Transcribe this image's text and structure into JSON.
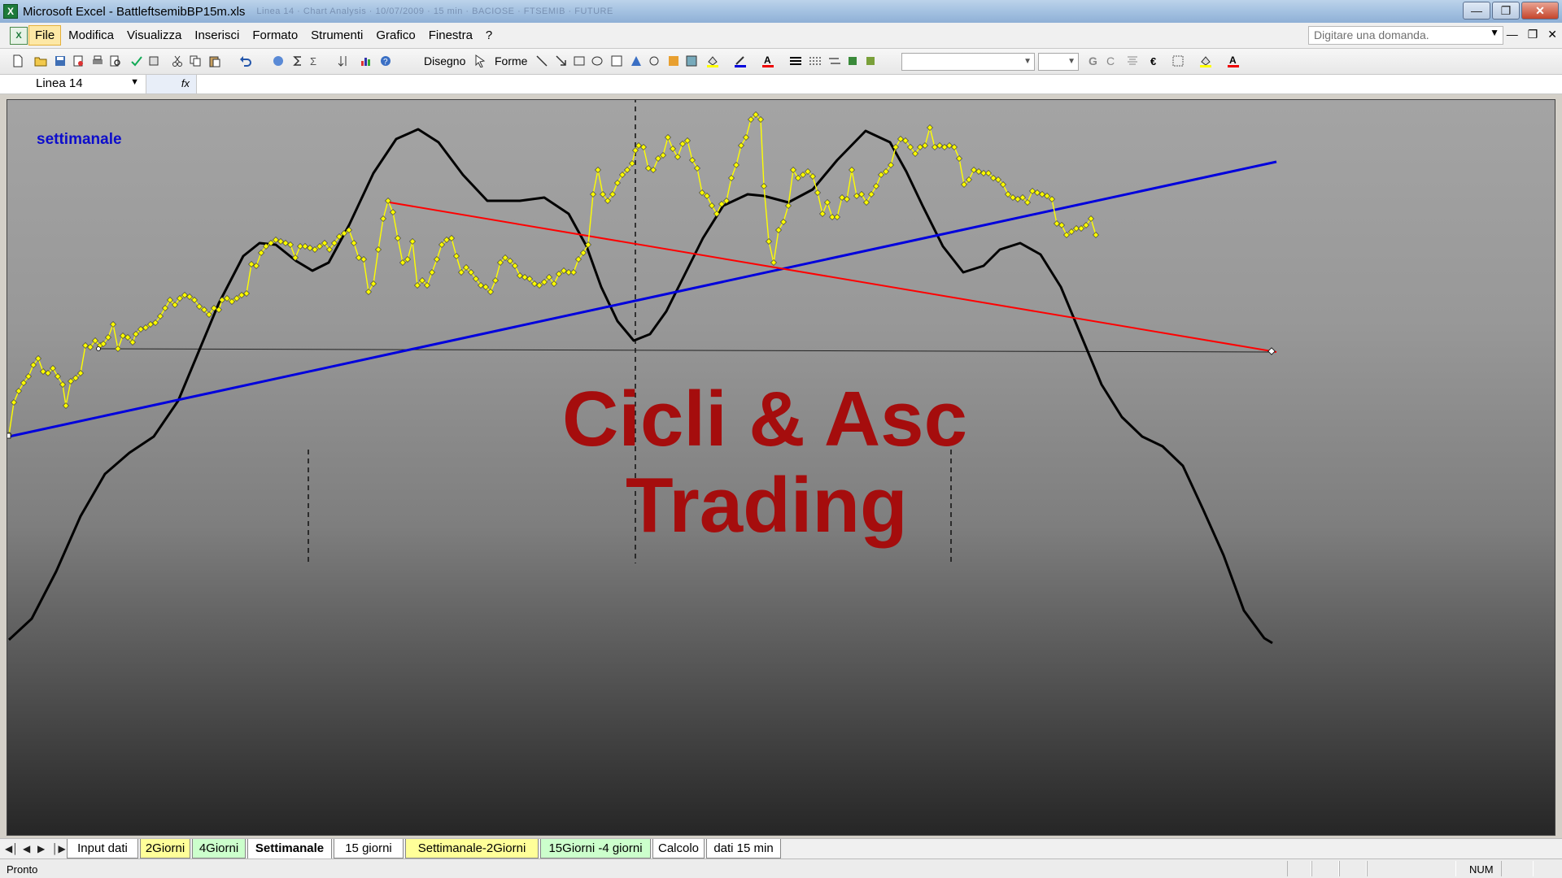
{
  "window": {
    "title": "Microsoft Excel - BattleftsemibBP15m.xls",
    "title_ghost": "Linea 14 · Chart Analysis · 10/07/2009 · 15 min · BACIOSE · FTSEMIB · FUTURE"
  },
  "menu": {
    "items": [
      "File",
      "Modifica",
      "Visualizza",
      "Inserisci",
      "Formato",
      "Strumenti",
      "Grafico",
      "Finestra",
      "?"
    ],
    "ask_placeholder": "Digitare una domanda."
  },
  "toolbar": {
    "draw_label": "Disegno",
    "shapes_label": "Forme",
    "bold_label": "G",
    "italic_label": "C"
  },
  "formula_bar": {
    "name_box": "Linea 14",
    "fx": "fx"
  },
  "chart": {
    "title": "settimanale",
    "watermark_line1": "Cicli & Asc",
    "watermark_line2": "Trading",
    "colors": {
      "background_top": "#a4a4a4",
      "background_bottom": "#262626",
      "cycle_line": "#000000",
      "price_line": "#ffff00",
      "up_trendline": "#0000dd",
      "down_trendline": "#ff0000",
      "watermark": "#a50d0d",
      "title": "#0d0dcc"
    }
  },
  "sheet_tabs": {
    "active": "Settimanale",
    "tabs": [
      {
        "label": "Input dati",
        "color": "#ffffff"
      },
      {
        "label": "2Giorni",
        "color": "#ffff99"
      },
      {
        "label": "4Giorni",
        "color": "#ccffcc"
      },
      {
        "label": "Settimanale",
        "color": "#ffffff"
      },
      {
        "label": "15 giorni",
        "color": "#ffffff"
      },
      {
        "label": "Settimanale-2Giorni",
        "color": "#ffff99"
      },
      {
        "label": "15Giorni -4 giorni",
        "color": "#ccffcc"
      },
      {
        "label": "Calcolo",
        "color": "#ffffff"
      },
      {
        "label": "dati 15 min",
        "color": "#ffffff"
      }
    ]
  },
  "status": {
    "text": "Pronto",
    "num": "NUM"
  }
}
